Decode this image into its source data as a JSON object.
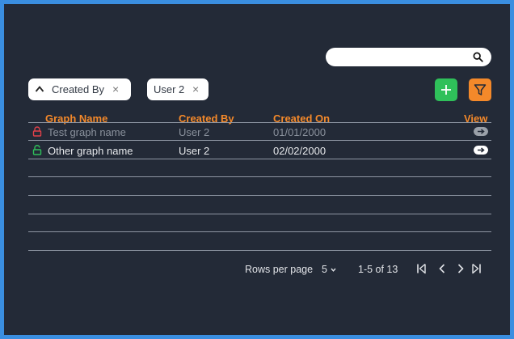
{
  "search": {
    "placeholder": ""
  },
  "chips": [
    {
      "label": "Created By",
      "remove": "×"
    },
    {
      "label": "User 2",
      "remove": "×"
    }
  ],
  "table": {
    "columns": [
      "Graph Name",
      "Created By",
      "Created On",
      "View"
    ],
    "rows": [
      {
        "name": "Test graph name",
        "created_by": "User 2",
        "created_on": "01/01/2000",
        "locked": true
      },
      {
        "name": "Other graph name",
        "created_by": "User 2",
        "created_on": "02/02/2000",
        "locked": false
      }
    ]
  },
  "pagination": {
    "rows_per_page_label": "Rows per page",
    "rows_per_page_value": "5",
    "range": "1-5 of 13"
  },
  "colors": {
    "background": "#232a37",
    "accent_orange": "#f4892a",
    "add_green": "#2fc05a",
    "lock_red": "#e0414a",
    "lock_green": "#2fc05a",
    "frame_blue": "#3a8ee0"
  },
  "icons": [
    "search-icon",
    "chevron-up-icon",
    "close-icon",
    "plus-icon",
    "filter-icon",
    "lock-icon",
    "unlock-icon",
    "arrow-right-icon",
    "first-page-icon",
    "prev-page-icon",
    "next-page-icon",
    "last-page-icon",
    "dropdown-arrow-icon"
  ]
}
